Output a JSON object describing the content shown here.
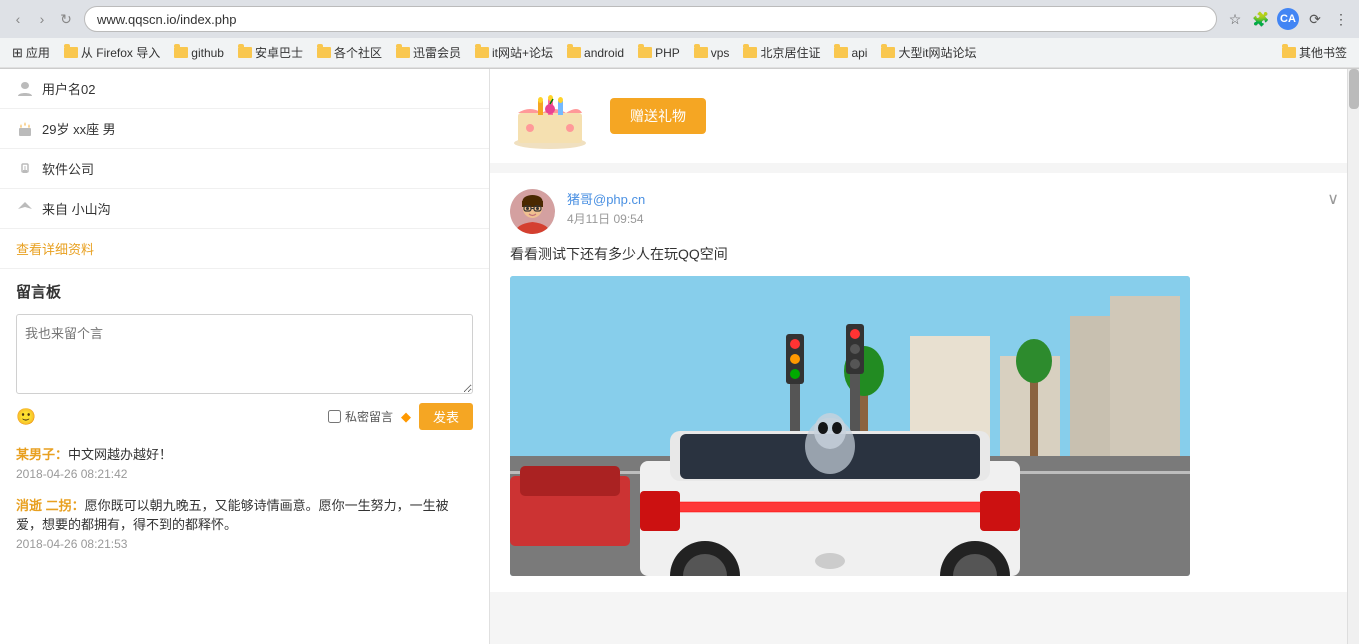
{
  "browser": {
    "url": "www.qqscn.io/index.php",
    "back_label": "‹",
    "forward_label": "›",
    "refresh_label": "↻",
    "menu_label": "☰"
  },
  "bookmarks": {
    "apps_label": "应用",
    "items": [
      {
        "label": "从 Firefox 导入",
        "type": "folder"
      },
      {
        "label": "github",
        "type": "folder"
      },
      {
        "label": "安卓巴士",
        "type": "folder"
      },
      {
        "label": "各个社区",
        "type": "folder"
      },
      {
        "label": "迅雷会员",
        "type": "folder"
      },
      {
        "label": "it网站+论坛",
        "type": "folder"
      },
      {
        "label": "android",
        "type": "folder"
      },
      {
        "label": "PHP",
        "type": "folder"
      },
      {
        "label": "vps",
        "type": "folder"
      },
      {
        "label": "北京居住证",
        "type": "folder"
      },
      {
        "label": "api",
        "type": "folder"
      },
      {
        "label": "大型it网站论坛",
        "type": "folder"
      },
      {
        "label": "其他书签",
        "type": "folder"
      }
    ]
  },
  "profile": {
    "username_label": "用户名02",
    "age_label": "29岁 xx座 男",
    "company_label": "软件公司",
    "location_label": "来自 小山沟",
    "view_profile_label": "查看详细资料"
  },
  "guestbook": {
    "title": "留言板",
    "placeholder": "我也来留个言",
    "private_label": "私密留言",
    "submit_label": "发表",
    "entries": [
      {
        "author": "某男子",
        "colon": "：",
        "text": "中文网越办越好！",
        "time": "2018-04-26 08:21:42"
      },
      {
        "author": "消逝 二拐",
        "colon": "：",
        "text": "愿你既可以朝九晚五，又能够诗情画意。愿你一生努力，一生被爱，想要的都拥有，得不到的都释怀。",
        "time": "2018-04-26 08:21:53"
      }
    ]
  },
  "gift_section": {
    "button_label": "赠送礼物"
  },
  "post": {
    "author": "猪哥@php.cn",
    "time": "4月11日 09:54",
    "text": "看看测试下还有多少人在玩QQ空间",
    "expand_icon": "∨"
  },
  "icons": {
    "username": "👤",
    "birthday": "🎂",
    "company": "🔒",
    "location": "✈",
    "emoji": "🙂",
    "vip": "◆",
    "apps": "⊞"
  },
  "colors": {
    "orange": "#f5a623",
    "link_blue": "#4a90e2",
    "text_dark": "#333333",
    "text_gray": "#999999",
    "author_orange": "#e8a020",
    "border": "#e0e0e0"
  }
}
